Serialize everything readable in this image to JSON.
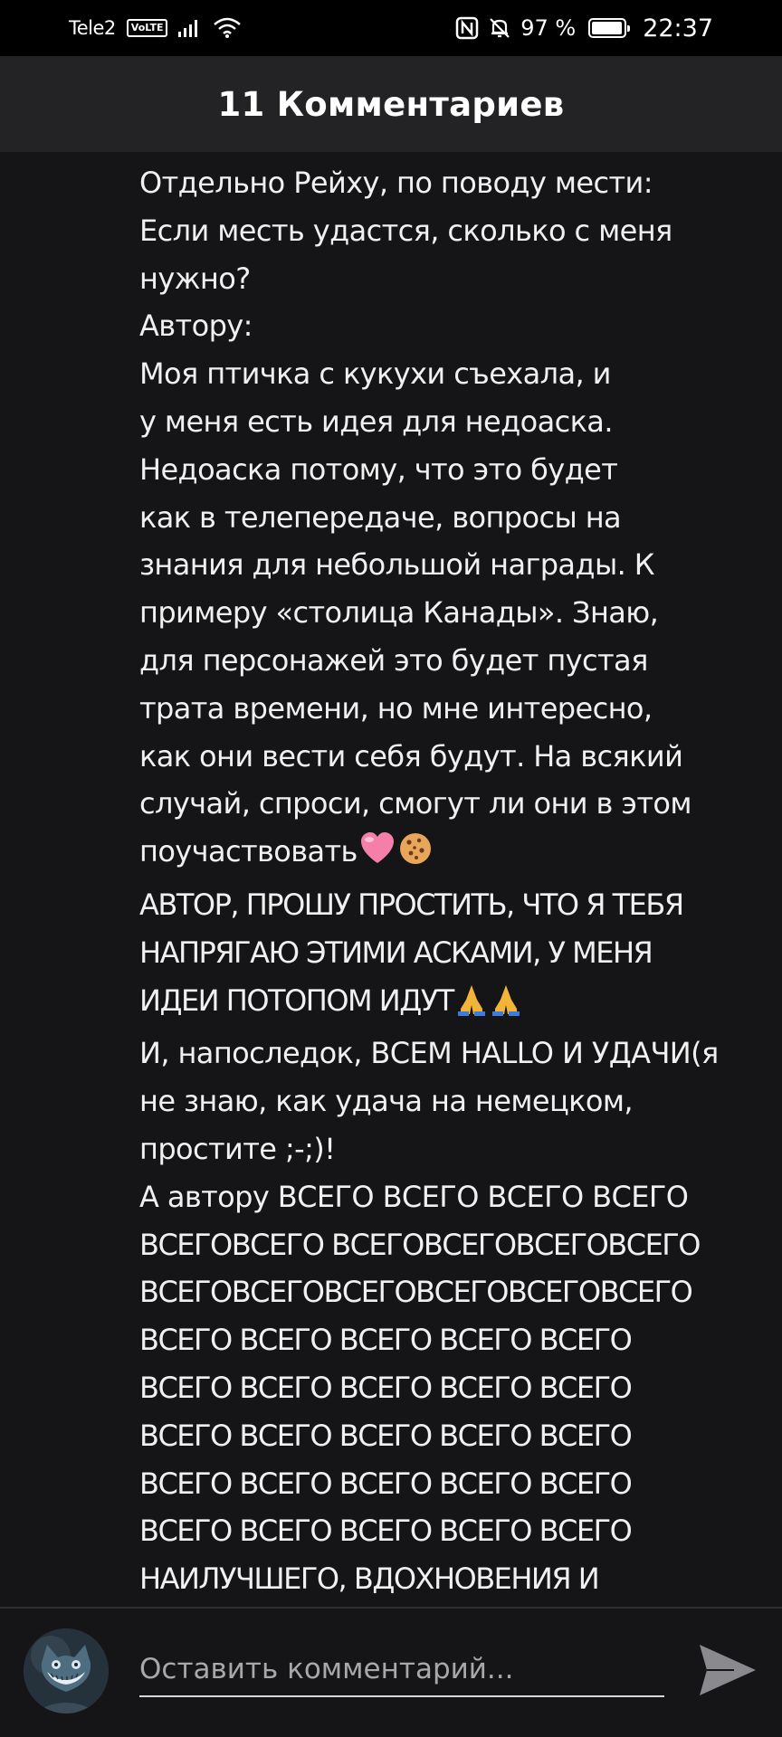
{
  "status_bar": {
    "carrier": "Tele2",
    "volte": "VoLTE",
    "battery_percent": "97 %",
    "battery_level": 0.97,
    "time": "22:37",
    "icons": [
      "signal-icon",
      "wifi-icon",
      "nfc-icon",
      "mute-icon",
      "battery-icon"
    ]
  },
  "header": {
    "title": "11 Комментариев"
  },
  "comment": {
    "lines": [
      "Отдельно Рейху, по поводу мести:",
      "Если месть удастся, сколько с меня",
      "нужно?",
      "Автору:",
      "Моя птичка с кукухи съехала, и",
      "у меня есть идея для недоаска.",
      "Недоаска потому, что это будет",
      "как в телепередаче, вопросы на",
      "знания для небольшой награды. К",
      "примеру «столица Канады». Знаю,",
      "для персонажей это будет пустая",
      "трата времени, но мне интересно,",
      "как они вести себя будут. На всякий",
      "случай, спроси, смогут ли они в этом",
      "поучаствовать",
      "АВТОР, ПРОШУ ПРОСТИТЬ, ЧТО Я ТЕБЯ",
      "НАПРЯГАЮ ЭТИМИ АСКАМИ, У МЕНЯ",
      "ИДЕИ ПОТОПОМ ИДУТ",
      "И, напоследок, ВСЕМ HALLO И УДАЧИ(я",
      "не знаю, как удача на немецком,",
      "простите ;-;)!",
      "А автору ВСЕГО ВСЕГО ВСЕГО ВСЕГО",
      "ВСЕГОВСЕГО ВСЕГОВСЕГОВСЕГОВСЕГО",
      "ВСЕГОВСЕГОВСЕГОВСЕГОВСЕГОВСЕГО",
      "ВСЕГО ВСЕГО ВСЕГО ВСЕГО ВСЕГО",
      "ВСЕГО ВСЕГО ВСЕГО ВСЕГО ВСЕГО",
      "ВСЕГО ВСЕГО ВСЕГО ВСЕГО ВСЕГО",
      "ВСЕГО ВСЕГО ВСЕГО ВСЕГО ВСЕГО",
      "ВСЕГО ВСЕГО ВСЕГО ВСЕГО ВСЕГО",
      "НАИЛУЧШЕГО, ВДОХНОВЕНИЯ И"
    ],
    "emoji_pink_heart": "pink-heart-emoji",
    "emoji_cookie": "cookie-emoji",
    "emoji_pray": "folded-hands-emoji"
  },
  "composer": {
    "placeholder": "Оставить комментарий...",
    "value": "",
    "avatar_icon": "cat-avatar",
    "send_icon": "send-icon"
  },
  "colors": {
    "background": "#151416",
    "header": "#232224",
    "status_bar": "#000000",
    "text": "#f0f0f0",
    "placeholder": "#a8a8aa"
  }
}
